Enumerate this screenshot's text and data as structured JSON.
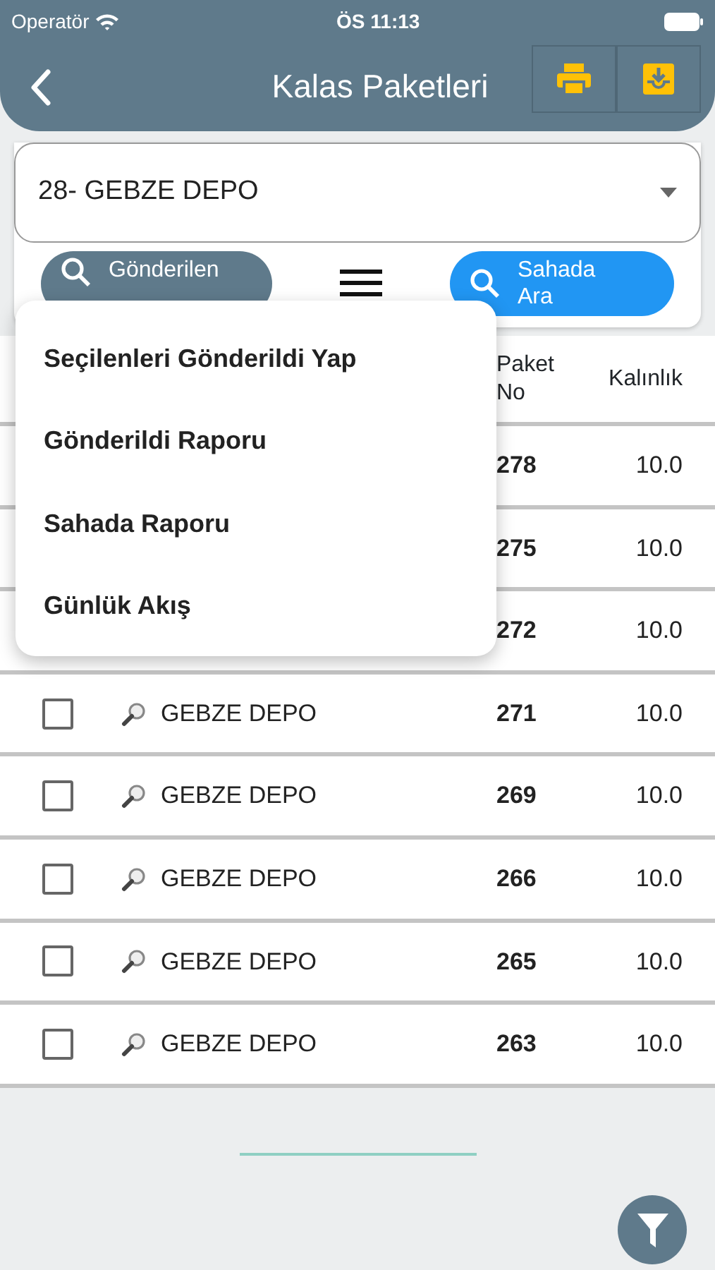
{
  "status_bar": {
    "carrier": "Operatör",
    "time": "ÖS 11:13"
  },
  "header": {
    "title": "Kalas Paketleri"
  },
  "depot_select": {
    "value": "28- GEBZE DEPO"
  },
  "search_buttons": [
    {
      "label": "Gönderilen",
      "kind": "sent"
    },
    {
      "label": "Sahada Ara",
      "kind": "field"
    }
  ],
  "menu": {
    "items": [
      "Seçilenleri Gönderildi Yap",
      "Gönderildi Raporu",
      "Sahada Raporu",
      "Günlük Akış"
    ]
  },
  "table": {
    "columns": [
      "Paket No",
      "Kalınlık"
    ],
    "rows": [
      {
        "paket_no": "278",
        "kalinlik": "10.0"
      },
      {
        "paket_no": "275",
        "kalinlik": "10.0"
      },
      {
        "paket_no": "272",
        "kalinlik": "10.0"
      },
      {
        "checked": false,
        "depot": "GEBZE DEPO",
        "paket_no": "271",
        "kalinlik": "10.0"
      },
      {
        "checked": false,
        "depot": "GEBZE DEPO",
        "paket_no": "269",
        "kalinlik": "10.0"
      },
      {
        "checked": false,
        "depot": "GEBZE DEPO",
        "paket_no": "266",
        "kalinlik": "10.0"
      },
      {
        "checked": false,
        "depot": "GEBZE DEPO",
        "paket_no": "265",
        "kalinlik": "10.0"
      },
      {
        "checked": false,
        "depot": "GEBZE DEPO",
        "paket_no": "263",
        "kalinlik": "10.0"
      }
    ]
  }
}
